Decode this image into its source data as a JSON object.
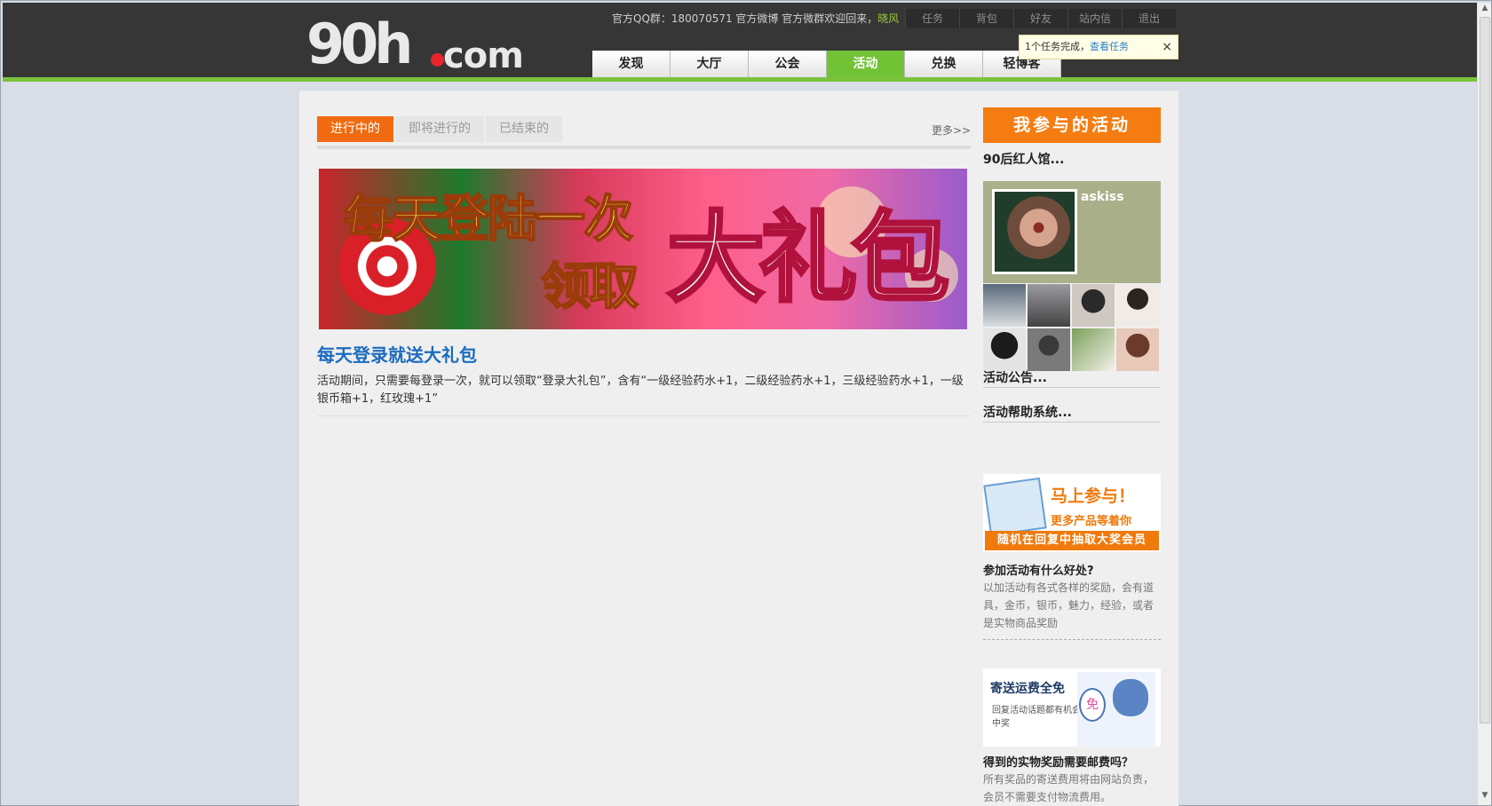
{
  "header": {
    "logo_main": "90h",
    "logo_suffix": "com",
    "welcome_text": "官方QQ群：180070571 官方微博 官方微群欢迎回来，",
    "username": "晓风",
    "top_links": [
      "任务",
      "背包",
      "好友",
      "站内信",
      "退出"
    ],
    "main_nav": [
      "发现",
      "大厅",
      "公会",
      "活动",
      "兑换",
      "轻博客"
    ],
    "active_nav": "活动",
    "task_notice": "1个任务完成，",
    "task_link": "查看任务",
    "close": "×"
  },
  "tabs": [
    "进行中的",
    "即将进行的",
    "已结束的"
  ],
  "more_link": "更多>>",
  "activity": {
    "banner_line1": "每天登陆一次",
    "banner_line2": "领取",
    "banner_big": "大礼包",
    "title": "每天登录就送大礼包",
    "description": "活动期间，只需要每登录一次，就可以领取“登录大礼包”，含有“一级经验药水+1，二级经验药水+1，三级经验药水+1，一级银币箱+1，红玫瑰+1”"
  },
  "sidebar": {
    "my_activities": "我参与的活动",
    "club": "90后红人馆...",
    "profile_name": "askiss",
    "announce": "活动公告...",
    "help": "活动帮助系统...",
    "promo1_title": "马上参与！",
    "promo1_sub": "更多产品等着你",
    "promo1_bar": "随机在回复中抽取大奖会员",
    "q1": "参加活动有什么好处?",
    "a1": "以加活动有各式各样的奖励，会有道具，金币，银币，魅力，经验，或者是实物商品奖励",
    "promo2_title": "寄送运费全免",
    "promo2_sub": "回复活动话题都有机会中奖",
    "promo2_badge": "免",
    "q2": "得到的实物奖励需要邮费吗？",
    "a2": "所有奖品的寄送费用将由网站负责，会员不需要支付物流费用。"
  },
  "colors": {
    "nav_active": "#72c236",
    "tab_active": "#f06a0f",
    "sidebar_header": "#f57c10",
    "title_link": "#1b6bbf"
  }
}
